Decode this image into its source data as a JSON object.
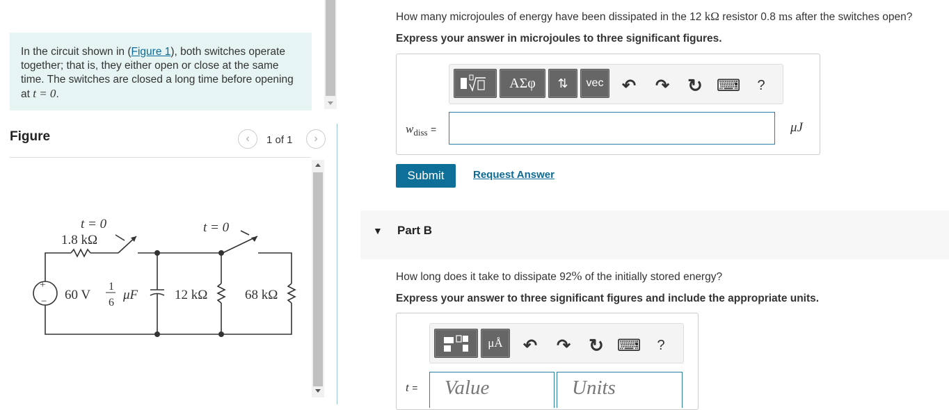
{
  "problem": {
    "intro": "In the circuit shown in (",
    "figure_link": "Figure 1",
    "rest": "), both switches operate together; that is, they either open or close at the same time. The switches are closed a long time before opening at ",
    "time_expr": "t = 0",
    "end": "."
  },
  "figure": {
    "heading": "Figure",
    "pager": "1 of 1",
    "prev_icon": "‹",
    "next_icon": "›",
    "circuit": {
      "switch1_label": "t = 0",
      "switch2_label": "t = 0",
      "r1": "1.8 kΩ",
      "source": "60 V",
      "cap_frac_num": "1",
      "cap_frac_den": "6",
      "cap_unit": "μF",
      "r2": "12 kΩ",
      "r3": "68 kΩ"
    }
  },
  "part_a": {
    "question_pre": "How many microjoules of energy have been dissipated in the 12",
    "question_unit1": "kΩ",
    "question_mid": "resistor 0.8",
    "question_unit2": "ms",
    "question_post": "after the switches open?",
    "instruction": "Express your answer in microjoules to three significant figures.",
    "toolbar": {
      "btn_templates": "templates",
      "btn_greek": "ΑΣφ",
      "btn_arrows": "⇅",
      "btn_vec": "vec",
      "undo": "↶",
      "redo": "↷",
      "reset": "↻",
      "keyboard": "⌨",
      "help": "?"
    },
    "var_label": "wdiss",
    "var_main": "w",
    "var_sub": "diss",
    "equals": "=",
    "input_value": "",
    "unit": "μJ"
  },
  "actions": {
    "submit": "Submit",
    "request_answer": "Request Answer"
  },
  "part_b": {
    "title": "Part B",
    "toggle_icon": "▼",
    "question_pre": "How long does it take to dissipate 92",
    "question_pct": "%",
    "question_post": "of the initially stored energy?",
    "instruction": "Express your answer to three significant figures and include the appropriate units.",
    "toolbar": {
      "btn_templates": "templates",
      "btn_units": "μÅ",
      "undo": "↶",
      "redo": "↷",
      "reset": "↻",
      "keyboard": "⌨",
      "help": "?"
    },
    "var_label": "t",
    "equals": "=",
    "value_placeholder": "Value",
    "units_placeholder": "Units"
  },
  "colors": {
    "accent": "#0e7099",
    "link": "#0c6a94",
    "problem_bg": "#e6f4f4",
    "toolbar_button": "#666666"
  }
}
